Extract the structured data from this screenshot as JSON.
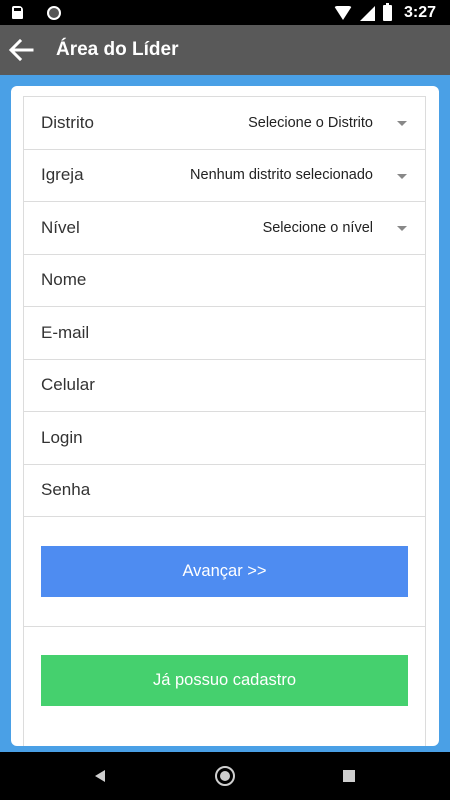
{
  "status_bar": {
    "time": "3:27",
    "icons": [
      "sd-card-icon",
      "sync-icon",
      "wifi-icon",
      "signal-icon",
      "battery-charging-icon"
    ]
  },
  "toolbar": {
    "back_icon": "arrow-left-icon",
    "title": "Área do Líder",
    "color": "#595959"
  },
  "form": {
    "fields": [
      {
        "label": "Distrito",
        "type": "select",
        "value": "Selecione o Distrito"
      },
      {
        "label": "Igreja",
        "type": "select",
        "value": "Nenhum distrito selecionado"
      },
      {
        "label": "Nível",
        "type": "select",
        "value": "Selecione o nível"
      },
      {
        "label": "Nome",
        "type": "text",
        "value": ""
      },
      {
        "label": "E-mail",
        "type": "text",
        "value": ""
      },
      {
        "label": "Celular",
        "type": "text",
        "value": ""
      },
      {
        "label": "Login",
        "type": "text",
        "value": ""
      },
      {
        "label": "Senha",
        "type": "password",
        "value": ""
      }
    ],
    "primary_button": {
      "label": "Avançar >>",
      "color": "#4e8cf1"
    },
    "secondary_button": {
      "label": "Já possuo cadastro",
      "color": "#45d06e"
    }
  },
  "colors": {
    "background": "#4aa0e6"
  },
  "nav_bar": {
    "buttons": [
      "back-triangle-icon",
      "home-circle-icon",
      "recents-square-icon"
    ]
  }
}
